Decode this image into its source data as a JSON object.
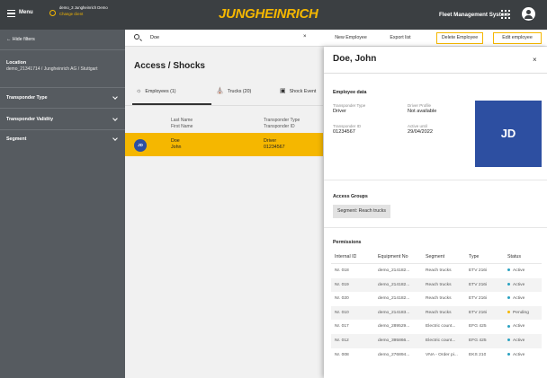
{
  "header": {
    "menu_label": "Menu",
    "client_name": "demo_3 Jungheinrich Demo",
    "client_action": "Change client",
    "logo_text": "JUNGHEINRICH",
    "app_title": "Fleet Management System",
    "accent_color": "#f5b700"
  },
  "sidebar": {
    "hide_filters": "← Hide filters",
    "location_title": "Location",
    "location_value": "demo_21341714 / Jungheinrich AG / Stuttgart",
    "filters": [
      {
        "label": "Transponder Type"
      },
      {
        "label": "Transponder Validity"
      },
      {
        "label": "Segment"
      }
    ]
  },
  "search": {
    "value": "Doe",
    "clear": "×"
  },
  "toolbar": {
    "new_employee": "New Employee",
    "export_list": "Export list",
    "delete_employee": "Delete Employee",
    "edit_employee": "Edit employee"
  },
  "page": {
    "title": "Access / Shocks",
    "tabs": [
      {
        "label": "Employees (1)",
        "icon": "people-icon"
      },
      {
        "label": "Trucks (20)",
        "icon": "forklift-icon"
      },
      {
        "label": "Shock Event",
        "icon": "calendar-icon"
      }
    ],
    "columns": {
      "name_top": "Last Name",
      "name_bottom": "First Name",
      "transponder_top": "Transponder Type",
      "transponder_bottom": "Transponder ID"
    },
    "selected_row": {
      "avatar": "JD",
      "last_name": "Doe",
      "first_name": "John",
      "transponder_type": "Driver",
      "transponder_id": "01234567"
    }
  },
  "panel": {
    "name": "Doe, John",
    "close": "×",
    "employee_data_title": "Employee data",
    "fields": {
      "transponder_type_label": "Transponder Type",
      "transponder_type_value": "Driver",
      "driver_profile_label": "Driver Profile",
      "driver_profile_value": "Not available",
      "transponder_id_label": "Transponder ID",
      "transponder_id_value": "01234567",
      "active_until_label": "Active until",
      "active_until_value": "29/04/2022"
    },
    "initials": "JD",
    "access_groups_title": "Access Groups",
    "access_group_chip": "Segment: Reach trucks",
    "permissions_title": "Permissions",
    "permissions_columns": [
      "Internal ID",
      "Equipment No",
      "Segment",
      "Type",
      "Status"
    ],
    "permissions_rows": [
      {
        "id": "Nr. 018",
        "equipment": "demo_214182...",
        "segment": "Reach trucks",
        "type": "ETV 216i",
        "status": "Active",
        "status_color": "#2aa1c0"
      },
      {
        "id": "Nr. 019",
        "equipment": "demo_214182...",
        "segment": "Reach trucks",
        "type": "ETV 216i",
        "status": "Active",
        "status_color": "#2aa1c0"
      },
      {
        "id": "Nr. 020",
        "equipment": "demo_214182...",
        "segment": "Reach trucks",
        "type": "ETV 216i",
        "status": "Active",
        "status_color": "#2aa1c0"
      },
      {
        "id": "Nr. 010",
        "equipment": "demo_214183...",
        "segment": "Reach trucks",
        "type": "ETV 216i",
        "status": "Pending",
        "status_color": "#f5b700"
      },
      {
        "id": "Nr. 017",
        "equipment": "demo_289529...",
        "segment": "Electric count...",
        "type": "EFG 425",
        "status": "Active",
        "status_color": "#2aa1c0"
      },
      {
        "id": "Nr. 012",
        "equipment": "demo_395866...",
        "segment": "Electric count...",
        "type": "EFG 425",
        "status": "Active",
        "status_color": "#2aa1c0"
      },
      {
        "id": "Nr. 008",
        "equipment": "demo_276894...",
        "segment": "VNA - Order pi...",
        "type": "EKS 210",
        "status": "Active",
        "status_color": "#2aa1c0"
      }
    ]
  }
}
